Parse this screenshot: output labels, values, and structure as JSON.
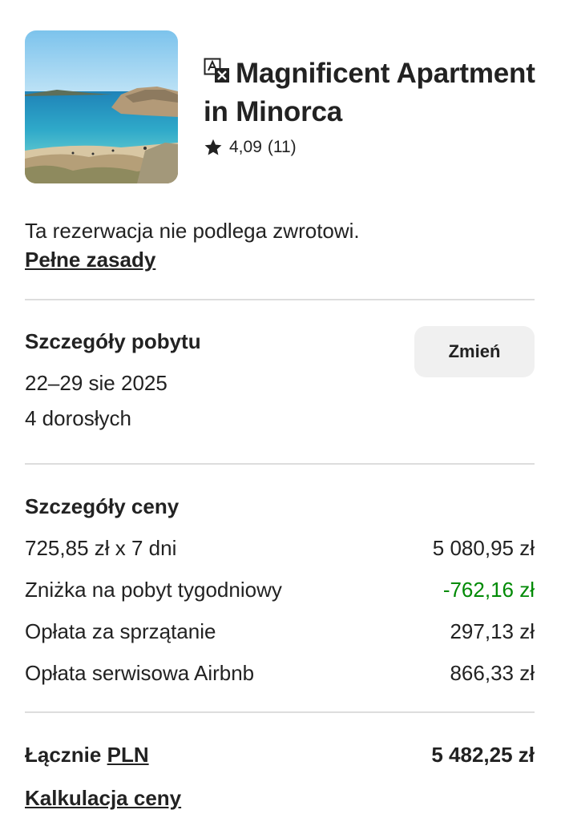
{
  "listing": {
    "title": "Magnificent Apartment in Minorca",
    "rating": "4,09",
    "reviews": "(11)",
    "thumbnail_icon": "beach-photo"
  },
  "icons": {
    "translate": "translate-icon",
    "star": "star-icon"
  },
  "policy": {
    "text": "Ta rezerwacja nie podlega zwrotowi.",
    "link": "Pełne zasady"
  },
  "stay": {
    "heading": "Szczegóły pobytu",
    "dates": "22–29 sie 2025",
    "guests": "4 dorosłych",
    "change_label": "Zmień"
  },
  "price": {
    "heading": "Szczegóły ceny",
    "lines": [
      {
        "label": "725,85 zł x 7 dni",
        "amount": "5 080,95 zł"
      },
      {
        "label": "Zniżka na pobyt tygodniowy",
        "amount": "-762,16 zł"
      },
      {
        "label": "Opłata za sprzątanie",
        "amount": "297,13 zł"
      },
      {
        "label": "Opłata serwisowa Airbnb",
        "amount": "866,33 zł"
      }
    ],
    "discount_color": "#008a05"
  },
  "total": {
    "label": "Łącznie",
    "currency": "PLN",
    "amount": "5 482,25 zł",
    "breakdown_link": "Kalkulacja ceny"
  }
}
